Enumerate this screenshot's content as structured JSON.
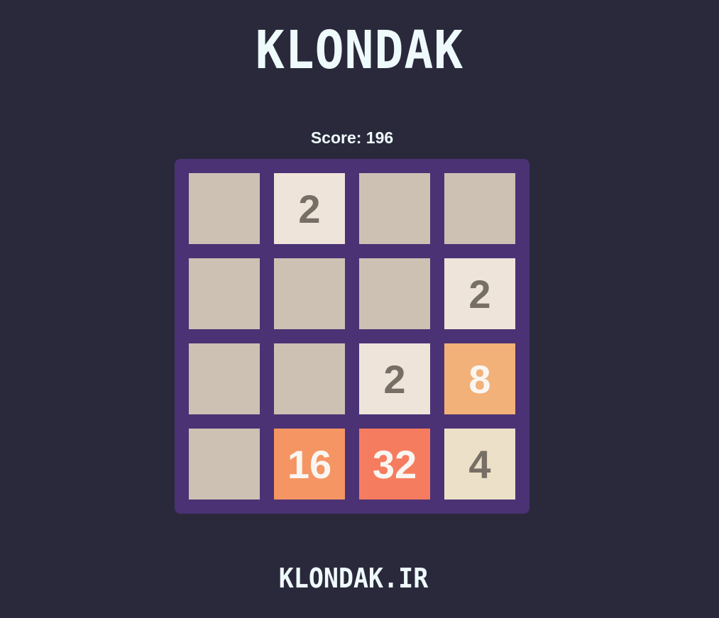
{
  "header": {
    "title": "KLONDAK",
    "score_label": "Score: 196"
  },
  "board": {
    "rows": 4,
    "cols": 4,
    "cells": [
      "",
      "2",
      "",
      "",
      "",
      "",
      "",
      "2",
      "",
      "",
      "2",
      "8",
      "",
      "16",
      "32",
      "4"
    ]
  },
  "tile_colors": {
    "empty": {
      "bg": "#cdc1b4",
      "fg": "#776e65"
    },
    "2": {
      "bg": "#eee4da",
      "fg": "#776e65"
    },
    "4": {
      "bg": "#ede0c8",
      "fg": "#776e65"
    },
    "8": {
      "bg": "#f2b179",
      "fg": "#f9f6f2"
    },
    "16": {
      "bg": "#f59563",
      "fg": "#f9f6f2"
    },
    "32": {
      "bg": "#f67c5f",
      "fg": "#f9f6f2"
    }
  },
  "colors": {
    "background": "#2a293b",
    "board": "#4b3274",
    "text": "#eefafc"
  },
  "footer": {
    "site": "KLONDAK.IR"
  }
}
